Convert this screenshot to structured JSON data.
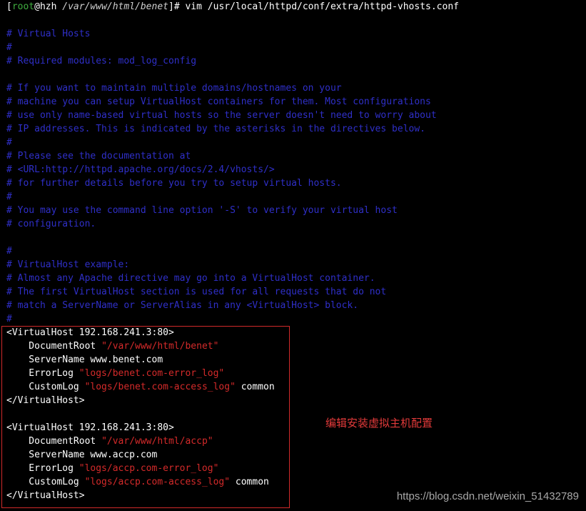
{
  "prompt": {
    "bracket_open": "[",
    "user": "root",
    "at": "@hzh",
    "cwd": "/var/www/html/benet",
    "bracket_close": "]#",
    "command": " vim /usr/local/httpd/conf/extra/httpd-vhosts.conf"
  },
  "comments": [
    "# Virtual Hosts",
    "#",
    "# Required modules: mod_log_config",
    "",
    "# If you want to maintain multiple domains/hostnames on your",
    "# machine you can setup VirtualHost containers for them. Most configurations",
    "# use only name-based virtual hosts so the server doesn't need to worry about",
    "# IP addresses. This is indicated by the asterisks in the directives below.",
    "#",
    "# Please see the documentation at",
    "# <URL:http://httpd.apache.org/docs/2.4/vhosts/>",
    "# for further details before you try to setup virtual hosts.",
    "#",
    "# You may use the command line option '-S' to verify your virtual host",
    "# configuration.",
    "",
    "#",
    "# VirtualHost example:",
    "# Almost any Apache directive may go into a VirtualHost container.",
    "# The first VirtualHost section is used for all requests that do not",
    "# match a ServerName or ServerAlias in any <VirtualHost> block.",
    "#"
  ],
  "vhost1": {
    "open": "<VirtualHost 192.168.241.3:80>",
    "docroot_key": "    DocumentRoot ",
    "docroot_val": "\"/var/www/html/benet\"",
    "servername": "    ServerName www.benet.com",
    "errorlog_key": "    ErrorLog ",
    "errorlog_val": "\"logs/benet.com-error_log\"",
    "customlog_key": "    CustomLog ",
    "customlog_val": "\"logs/benet.com-access_log\"",
    "customlog_tail": " common",
    "close": "</VirtualHost>"
  },
  "vhost2": {
    "open": "<VirtualHost 192.168.241.3:80>",
    "docroot_key": "    DocumentRoot ",
    "docroot_val": "\"/var/www/html/accp\"",
    "servername": "    ServerName www.accp.com",
    "errorlog_key": "    ErrorLog ",
    "errorlog_val": "\"logs/accp.com-error_log\"",
    "customlog_key": "    CustomLog ",
    "customlog_val": "\"logs/accp.com-access_log\"",
    "customlog_tail": " common",
    "close": "</VirtualHost>"
  },
  "annotation": "编辑安装虚拟主机配置",
  "watermark": "https://blog.csdn.net/weixin_51432789",
  "colors": {
    "background": "#000000",
    "comment": "#2f2fc8",
    "string": "#d42a2a",
    "highlight_box": "#d12a2a"
  }
}
